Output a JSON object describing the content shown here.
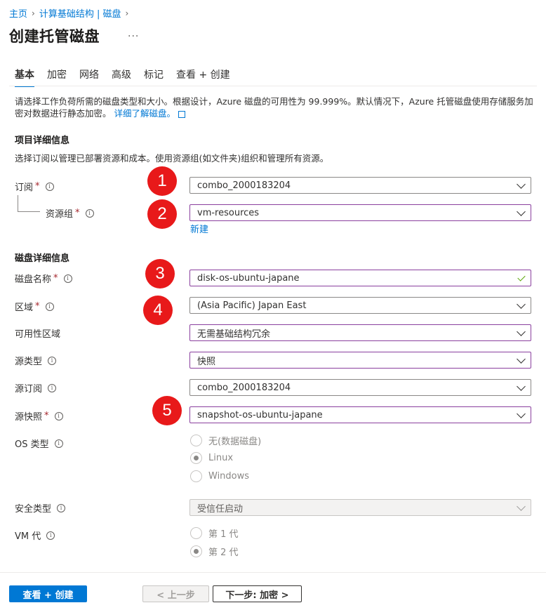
{
  "breadcrumb": {
    "home": "主页",
    "parent": "计算基础结构 | 磁盘"
  },
  "page": {
    "title": "创建托管磁盘",
    "more": "..."
  },
  "tabs": [
    "基本",
    "加密",
    "网络",
    "高级",
    "标记",
    "查看 + 创建"
  ],
  "intro": {
    "text": "请选择工作负荷所需的磁盘类型和大小。根据设计，Azure 磁盘的可用性为 99.999%。默认情况下，Azure 托管磁盘使用存储服务加密对数据进行静态加密。",
    "link": "详细了解磁盘。"
  },
  "project": {
    "heading": "项目详细信息",
    "desc": "选择订阅以管理已部署资源和成本。使用资源组(如文件夹)组织和管理所有资源。",
    "subscription_label": "订阅",
    "subscription_value": "combo_2000183204",
    "rg_label": "资源组",
    "rg_value": "vm-resources",
    "rg_new": "新建"
  },
  "disk": {
    "heading": "磁盘详细信息",
    "name_label": "磁盘名称",
    "name_value": "disk-os-ubuntu-japane",
    "region_label": "区域",
    "region_value": "(Asia Pacific) Japan East",
    "az_label": "可用性区域",
    "az_value": "无需基础结构冗余",
    "source_type_label": "源类型",
    "source_type_value": "快照",
    "source_sub_label": "源订阅",
    "source_sub_value": "combo_2000183204",
    "source_snap_label": "源快照",
    "source_snap_value": "snapshot-os-ubuntu-japane",
    "os_label": "OS 类型",
    "os_options": [
      "无(数据磁盘)",
      "Linux",
      "Windows"
    ],
    "security_label": "安全类型",
    "security_value": "受信任启动",
    "vmgen_label": "VM 代",
    "vmgen_options": [
      "第 1 代",
      "第 2 代"
    ]
  },
  "badges": [
    "1",
    "2",
    "3",
    "4",
    "5"
  ],
  "footer": {
    "review": "查看 + 创建",
    "prev": "< 上一步",
    "next": "下一步: 加密 >"
  },
  "required_mark": "*",
  "info_glyph": "i",
  "colors": {
    "accent": "#0078d4",
    "badge": "#e8191a",
    "focus_border": "#8a3f9e",
    "required": "#a4262c"
  }
}
